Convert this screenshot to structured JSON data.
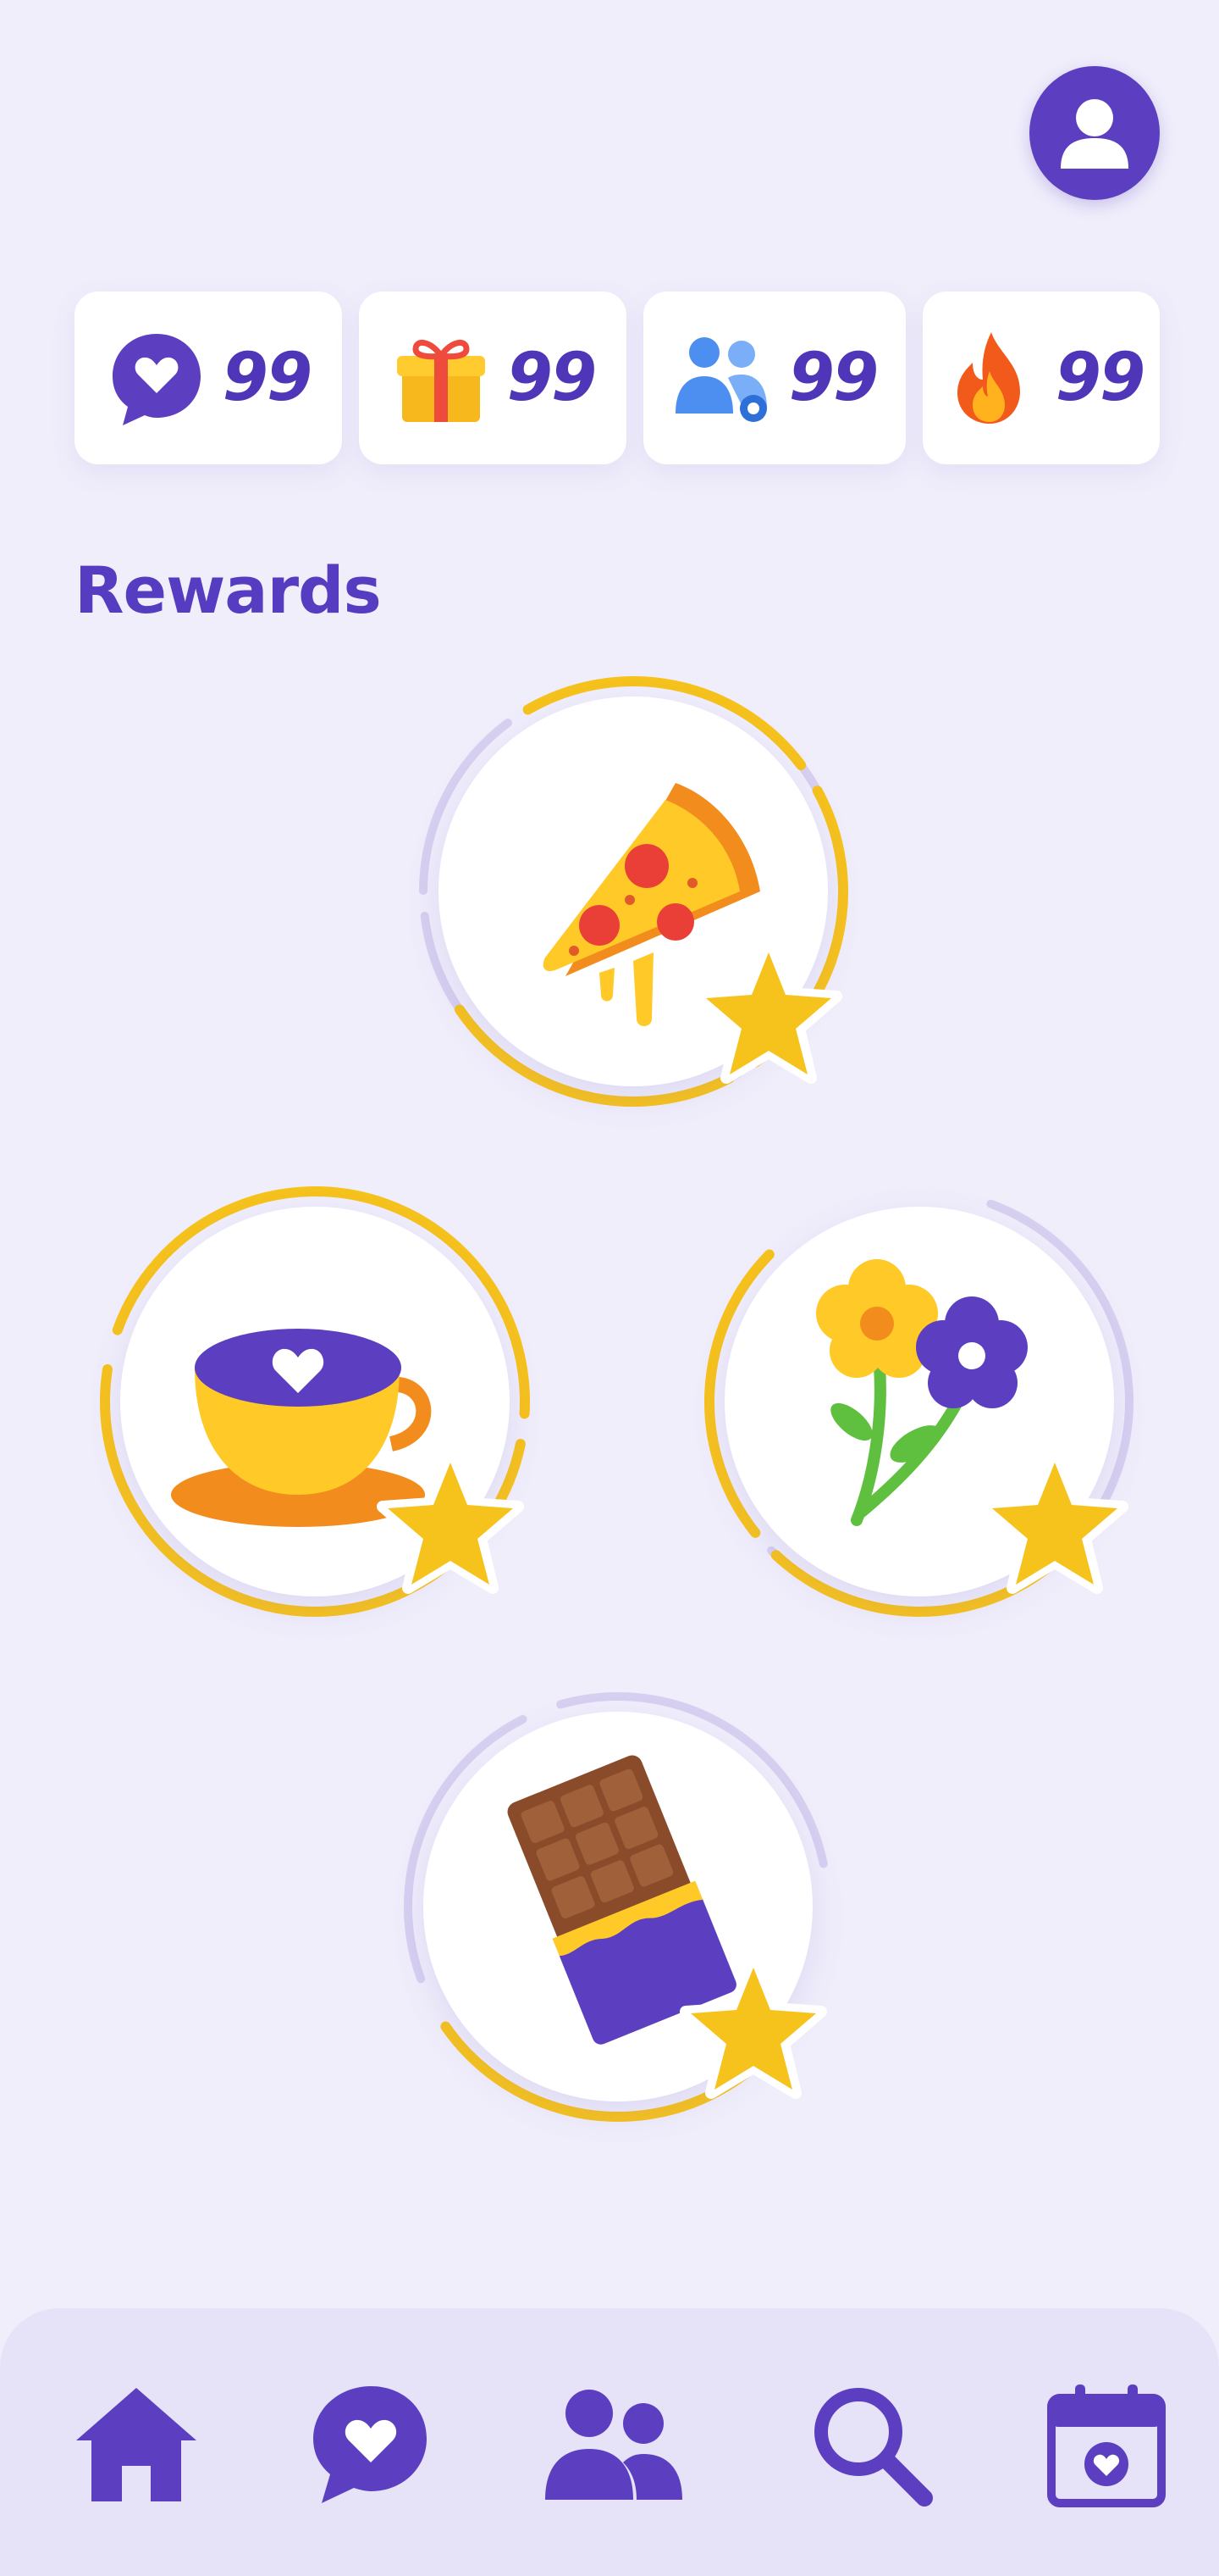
{
  "profile": {
    "avatar_icon": "user-icon"
  },
  "stats": [
    {
      "icon": "heart-chat-icon",
      "value": "99"
    },
    {
      "icon": "gift-icon",
      "value": "99"
    },
    {
      "icon": "people-icon",
      "value": "99"
    },
    {
      "icon": "fire-icon",
      "value": "99"
    }
  ],
  "rewards": {
    "title": "Rewards",
    "items": [
      {
        "icon": "pizza-icon",
        "progress": 0.72
      },
      {
        "icon": "coffee-cup-icon",
        "progress": 1.0
      },
      {
        "icon": "flowers-icon",
        "progress": 0.55
      },
      {
        "icon": "chocolate-bar-icon",
        "progress": 0.35
      }
    ]
  },
  "nav": {
    "items": [
      {
        "icon": "home-icon"
      },
      {
        "icon": "heart-chat-icon"
      },
      {
        "icon": "people-icon"
      },
      {
        "icon": "search-icon"
      },
      {
        "icon": "calendar-heart-icon"
      }
    ]
  },
  "colors": {
    "background": "#f0eefb",
    "accent": "#553cc0",
    "ring_done": "#f6c21c",
    "ring_todo": "#d7d0f0",
    "card": "#ffffff"
  }
}
